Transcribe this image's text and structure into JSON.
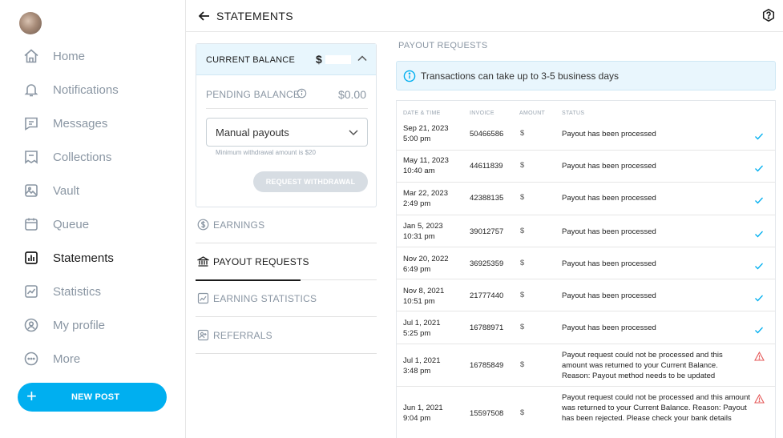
{
  "sidebar": {
    "items": [
      {
        "label": "Home",
        "icon": "home-icon"
      },
      {
        "label": "Notifications",
        "icon": "bell-icon"
      },
      {
        "label": "Messages",
        "icon": "message-icon"
      },
      {
        "label": "Collections",
        "icon": "bookmark-icon"
      },
      {
        "label": "Vault",
        "icon": "image-icon"
      },
      {
        "label": "Queue",
        "icon": "calendar-icon"
      },
      {
        "label": "Statements",
        "icon": "chart-bar-icon"
      },
      {
        "label": "Statistics",
        "icon": "trend-icon"
      },
      {
        "label": "My profile",
        "icon": "profile-icon"
      },
      {
        "label": "More",
        "icon": "more-icon"
      }
    ],
    "new_post_label": "NEW POST"
  },
  "header": {
    "title": "STATEMENTS"
  },
  "balance": {
    "current_label": "CURRENT BALANCE",
    "currency": "$",
    "pending_label": "PENDING BALANCE",
    "pending_value": "$0.00",
    "payout_mode": "Manual payouts",
    "min_withdrawal": "Minimum withdrawal amount is $20",
    "request_label": "REQUEST WITHDRAWAL"
  },
  "side_menu": [
    {
      "label": "EARNINGS",
      "icon": "dollar-circle-icon"
    },
    {
      "label": "PAYOUT REQUESTS",
      "icon": "bank-icon"
    },
    {
      "label": "EARNING STATISTICS",
      "icon": "stats-icon"
    },
    {
      "label": "REFERRALS",
      "icon": "referral-icon"
    }
  ],
  "payouts": {
    "title": "PAYOUT REQUESTS",
    "notice": "Transactions can take up to 3-5 business days",
    "columns": [
      "DATE & TIME",
      "INVOICE",
      "AMOUNT",
      "STATUS"
    ],
    "rows": [
      {
        "date": "Sep 21, 2023",
        "time": "5:00 pm",
        "invoice": "50466586",
        "amount": "$",
        "status": "Payout has been processed",
        "ok": true
      },
      {
        "date": "May 11, 2023",
        "time": "10:40 am",
        "invoice": "44611839",
        "amount": "$",
        "status": "Payout has been processed",
        "ok": true
      },
      {
        "date": "Mar 22, 2023",
        "time": "2:49 pm",
        "invoice": "42388135",
        "amount": "$",
        "status": "Payout has been processed",
        "ok": true
      },
      {
        "date": "Jan 5, 2023",
        "time": "10:31 pm",
        "invoice": "39012757",
        "amount": "$",
        "status": "Payout has been processed",
        "ok": true
      },
      {
        "date": "Nov 20, 2022",
        "time": "6:49 pm",
        "invoice": "36925359",
        "amount": "$",
        "status": "Payout has been processed",
        "ok": true
      },
      {
        "date": "Nov 8, 2021",
        "time": "10:51 pm",
        "invoice": "21777440",
        "amount": "$",
        "status": "Payout has been processed",
        "ok": true
      },
      {
        "date": "Jul 1, 2021",
        "time": "5:25 pm",
        "invoice": "16788971",
        "amount": "$",
        "status": "Payout has been processed",
        "ok": true
      },
      {
        "date": "Jul 1, 2021",
        "time": "3:48 pm",
        "invoice": "16785849",
        "amount": "$",
        "status": "Payout request could not be processed and this amount was returned to your Current Balance. Reason: Payout method needs to be updated",
        "ok": false
      },
      {
        "date": "Jun 1, 2021",
        "time": "9:04 pm",
        "invoice": "15597508",
        "amount": "$",
        "status": "Payout request could not be processed and this amount was returned to your Current Balance. Reason: Payout has been rejected. Please check your bank details",
        "ok": false
      }
    ]
  },
  "colors": {
    "accent": "#00aff0",
    "muted": "#8a96a3",
    "error": "#e55a5a"
  }
}
